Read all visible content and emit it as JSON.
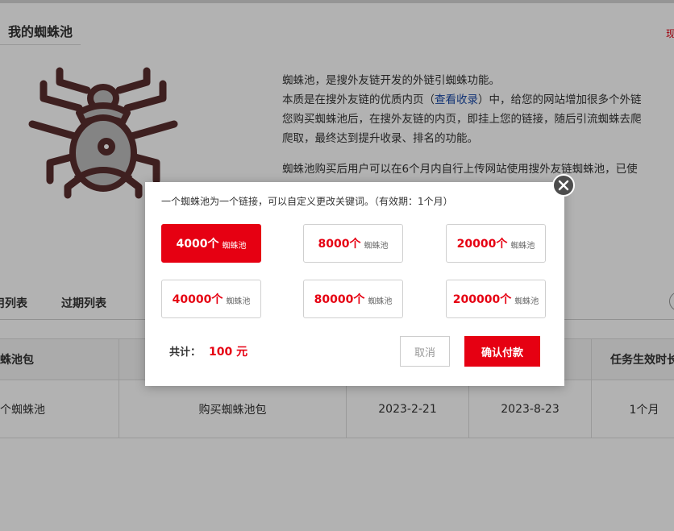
{
  "page": {
    "title": "我的蜘蛛池",
    "top_right_text": "现",
    "intro": {
      "line1": "蜘蛛池，是搜外友链开发的外链引蜘蛛功能。",
      "line2_a": "本质是在搜外友链的优质内页（",
      "line2_link": "查看收录",
      "line2_b": "）中，给您的网站增加很多个外链",
      "line3": "您购买蜘蛛池后，在搜外友链的内页，即挂上您的链接，随后引流蜘蛛去爬",
      "line4": "爬取，最终达到提升收录、排名的功能。",
      "line5": "蜘蛛池购买后用户可以在6个月内自行上传网站使用搜外友链蜘蛛池，已使"
    },
    "tabs": [
      "用列表",
      "过期列表"
    ],
    "table": {
      "headers": [
        "蛛池包",
        "",
        "",
        "",
        "任务生效时长"
      ],
      "rows": [
        [
          "个蜘蛛池",
          "购买蜘蛛池包",
          "2023-2-21",
          "2023-8-23",
          "1个月"
        ]
      ]
    }
  },
  "modal": {
    "description": "一个蜘蛛池为一个链接，可以自定义更改关键词。（有效期：1个月）",
    "unit": "蜘蛛池",
    "options": [
      {
        "count": "4000个",
        "selected": true
      },
      {
        "count": "8000个",
        "selected": false
      },
      {
        "count": "20000个",
        "selected": false
      },
      {
        "count": "40000个",
        "selected": false
      },
      {
        "count": "80000个",
        "selected": false
      },
      {
        "count": "200000个",
        "selected": false
      }
    ],
    "total_label": "共计：",
    "total_amount": "100 元",
    "cancel_label": "取消",
    "confirm_label": "确认付款"
  },
  "colors": {
    "accent": "#e60012",
    "link": "#1a4aa8",
    "spider": "#5a2e2e",
    "spider_body": "#bdbdbd"
  }
}
